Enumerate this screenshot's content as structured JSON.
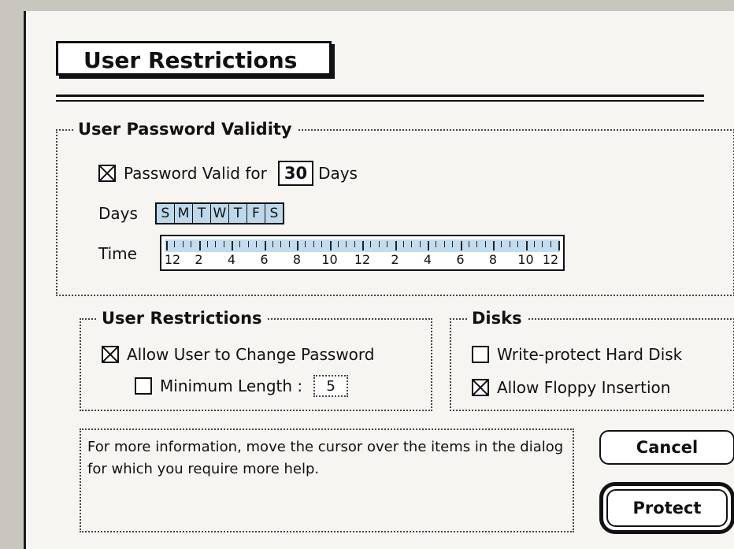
{
  "dialog": {
    "title": "User Restrictions"
  },
  "password_validity": {
    "group_title": "User Password Validity",
    "valid_for_label": "Password Valid for",
    "valid_for_checked": true,
    "days_value": "30",
    "days_unit": "Days",
    "days_label": "Days",
    "days": [
      "S",
      "M",
      "T",
      "W",
      "T",
      "F",
      "S"
    ],
    "time_label": "Time",
    "time_ticks": [
      "12",
      "2",
      "4",
      "6",
      "8",
      "10",
      "12",
      "2",
      "4",
      "6",
      "8",
      "10",
      "12"
    ]
  },
  "user_restrictions": {
    "group_title": "User Restrictions",
    "allow_change_label": "Allow User to Change Password",
    "allow_change_checked": true,
    "min_length_label": "Minimum Length :",
    "min_length_checked": false,
    "min_length_value": "5"
  },
  "disks": {
    "group_title": "Disks",
    "write_protect_label": "Write-protect Hard Disk",
    "write_protect_checked": false,
    "allow_floppy_label": "Allow Floppy Insertion",
    "allow_floppy_checked": true
  },
  "help": {
    "text": "For more information, move the cursor over the items in the dialog for which you require more help."
  },
  "buttons": {
    "cancel": "Cancel",
    "protect": "Protect"
  },
  "colors": {
    "selection_band": "#c3dcee",
    "day_cell": "#bdd8ea"
  }
}
